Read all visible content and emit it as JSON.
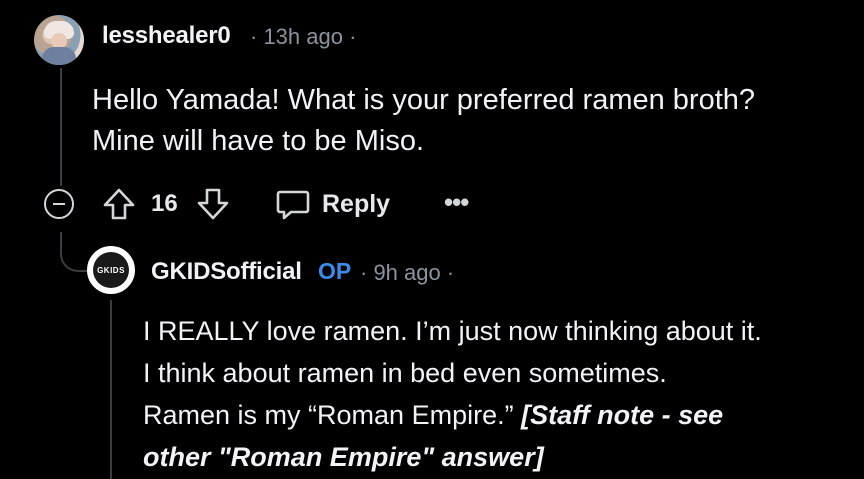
{
  "comment": {
    "username": "lesshealer0",
    "meta": "· 13h ago ·",
    "avatar_icon": "user-avatar-icon",
    "body_line1": "Hello Yamada! What is your preferred ramen broth?",
    "body_line2": "Mine will have to be Miso.",
    "score": "16",
    "reply_label": "Reply",
    "more_label": "•••"
  },
  "reply": {
    "username": "GKIDSofficial",
    "op_badge": "OP",
    "meta": "· 9h ago ·",
    "avatar_text": "GKIDS",
    "body_line1": "I REALLY love ramen. I’m just now thinking about it.",
    "body_line2": "I think about ramen in bed even sometimes.",
    "body_line3a": "Ramen is my “Roman Empire.” ",
    "staff_note_line1": "[Staff note - see",
    "staff_note_line2": "other \"Roman Empire\" answer]"
  },
  "colors": {
    "background": "#000000",
    "text": "#f2f3f5",
    "muted": "#8b949e",
    "op_badge": "#3d8be9"
  }
}
